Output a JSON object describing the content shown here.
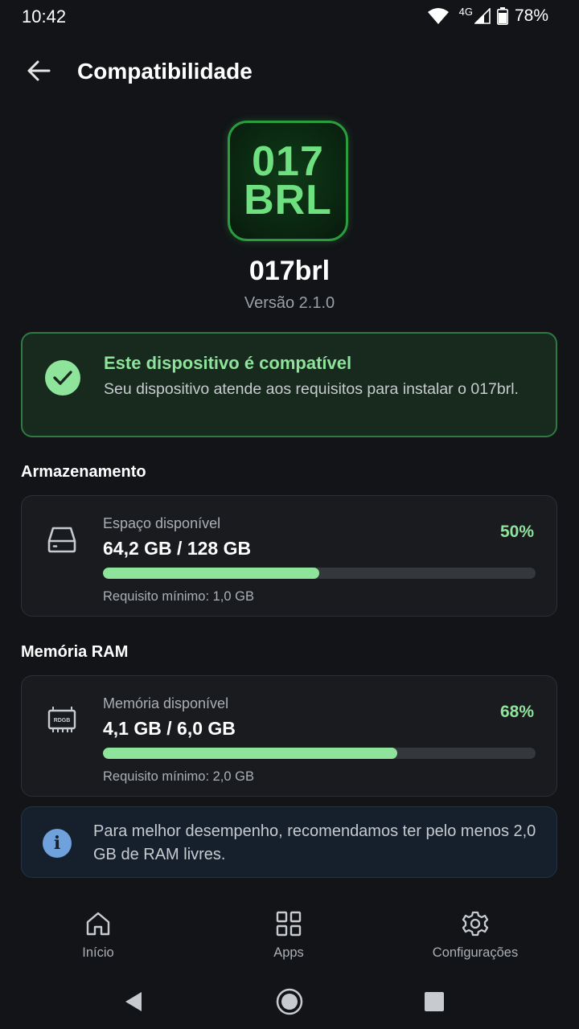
{
  "status": {
    "time": "10:42",
    "network": "4G",
    "battery": "78%"
  },
  "appbar": {
    "title": "Compatibilidade"
  },
  "app": {
    "logo_line1": "017",
    "logo_line2": "BRL",
    "name": "017brl",
    "version": "Versão 2.1.0"
  },
  "compat": {
    "title": "Este dispositivo é compatível",
    "description": "Seu dispositivo atende aos requisitos para instalar o 017brl."
  },
  "storage": {
    "section": "Armazenamento",
    "label": "Espaço disponível",
    "value": "64,2 GB / 128 GB",
    "percent_text": "50%",
    "percent": 50,
    "requirement": "Requisito mínimo: 1,0 GB",
    "icon": "hard-drive-icon"
  },
  "ram": {
    "section": "Memória RAM",
    "label": "Memória disponível",
    "value": "4,1 GB / 6,0 GB",
    "percent_text": "68%",
    "percent": 68,
    "requirement": "Requisito mínimo: 2,0 GB",
    "icon": "memory-chip-icon",
    "chip_text": "RDGB"
  },
  "info": {
    "text": "Para melhor desempenho, recomendamos ter pelo menos 2,0 GB de RAM livres."
  },
  "nav": {
    "items": [
      {
        "label": "Início",
        "icon": "home-icon"
      },
      {
        "label": "Apps",
        "icon": "apps-grid-icon"
      },
      {
        "label": "Configurações",
        "icon": "gear-icon"
      }
    ]
  },
  "colors": {
    "accent": "#8ee49a",
    "background": "#121417",
    "info": "#6fa2dc"
  }
}
